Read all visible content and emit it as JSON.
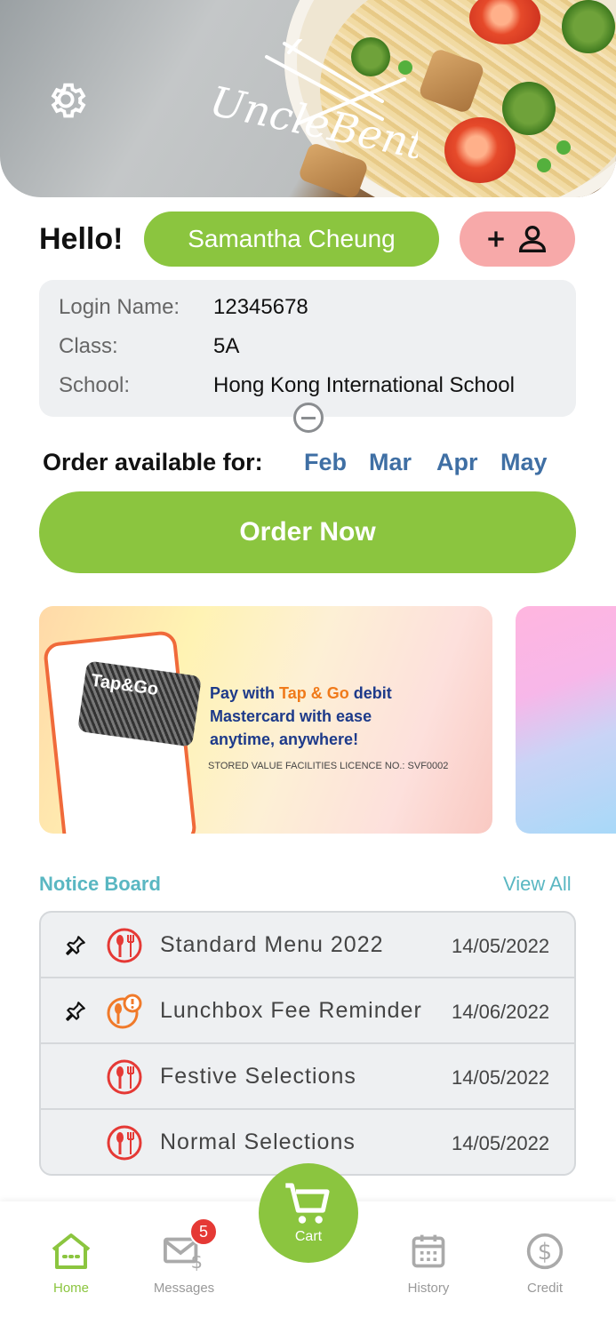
{
  "header": {
    "logo_text": "UncleBento"
  },
  "greeting": {
    "hello": "Hello!",
    "user_name": "Samantha Cheung"
  },
  "info": {
    "login_label": "Login Name:",
    "login_value": "12345678",
    "class_label": "Class:",
    "class_value": "5A",
    "school_label": "School:",
    "school_value": "Hong Kong International School"
  },
  "order": {
    "available_label": "Order available for:",
    "months": [
      "Feb",
      "Mar",
      "Apr",
      "May"
    ],
    "button_label": "Order Now"
  },
  "banner": {
    "line1_a": "Pay with ",
    "line1_brand": "Tap & Go",
    "line1_b": " debit",
    "line2": "Mastercard with ease",
    "line3": "anytime, anywhere!",
    "license": "STORED VALUE FACILITIES LICENCE NO.: SVF0002",
    "card_text": "Tap&Go"
  },
  "notice_board": {
    "title": "Notice Board",
    "view_all": "View All",
    "items": [
      {
        "title": "Standard Menu 2022",
        "date": "14/05/2022",
        "pinned": true,
        "icon": "meal-bowl-icon"
      },
      {
        "title": "Lunchbox Fee Reminder",
        "date": "14/06/2022",
        "pinned": true,
        "icon": "meal-alert-icon"
      },
      {
        "title": "Festive Selections",
        "date": "14/05/2022",
        "pinned": false,
        "icon": "meal-bowl-icon"
      },
      {
        "title": "Normal Selections",
        "date": "14/05/2022",
        "pinned": false,
        "icon": "meal-bowl-icon"
      }
    ]
  },
  "nav": {
    "home": "Home",
    "messages": "Messages",
    "cart": "Cart",
    "history": "History",
    "credit": "Credit",
    "messages_badge": "5"
  },
  "colors": {
    "accent_green": "#8bc53f",
    "link_teal": "#5ab7c2",
    "month_blue": "#3f6fa4",
    "pink": "#f7a9a9",
    "icon_red": "#e53935"
  }
}
